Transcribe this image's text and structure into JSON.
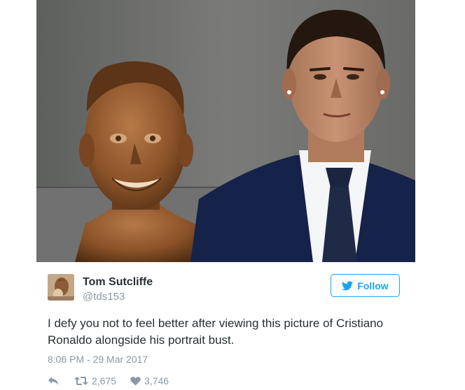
{
  "tweet": {
    "author": {
      "display_name": "Tom Sutcliffe",
      "handle": "@tds153"
    },
    "follow_label": "Follow",
    "text": "I defy you not to feel better after viewing this picture of Cristiano Ronaldo alongside his portrait bust.",
    "timestamp": "8:06 PM - 29 Mar 2017",
    "stats": {
      "retweets": "2,675",
      "likes": "3,746"
    }
  },
  "icons": {
    "follow": "twitter-bird-icon",
    "reply": "reply-arrow-icon",
    "retweet": "retweet-icon",
    "like": "heart-icon"
  },
  "colors": {
    "accent": "#1da1f2",
    "text": "#292f33",
    "muted": "#8899a6"
  }
}
